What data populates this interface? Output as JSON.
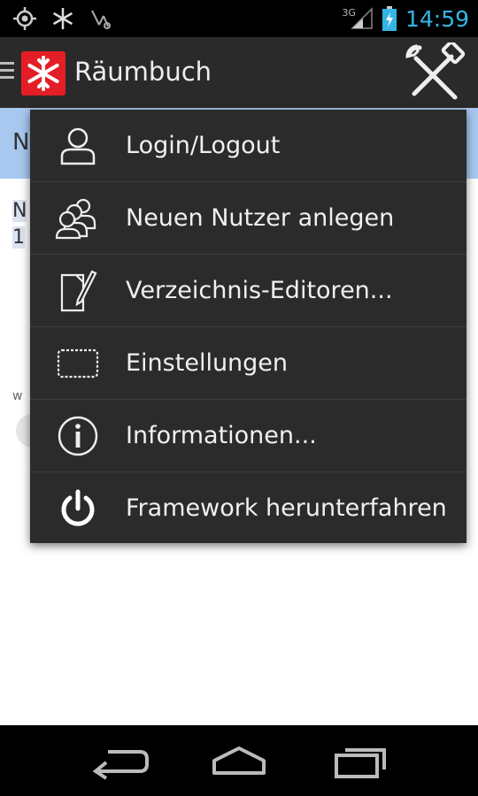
{
  "status_bar": {
    "network_type": "3G",
    "time": "14:59",
    "icons": [
      "gps-icon",
      "snowflake-notification-icon",
      "usb-debug-icon",
      "signal-icon",
      "battery-charging-icon"
    ]
  },
  "action_bar": {
    "title": "Räumbuch",
    "menu_icon": "tools-icon"
  },
  "background": {
    "strip_text": "N",
    "row1_text": "N",
    "row2_text": "1",
    "small_text": "w"
  },
  "menu": {
    "items": [
      {
        "label": "Login/Logout",
        "icon": "user-icon"
      },
      {
        "label": "Neuen Nutzer anlegen",
        "icon": "users-icon"
      },
      {
        "label": "Verzeichnis-Editoren...",
        "icon": "edit-document-icon"
      },
      {
        "label": "Einstellungen",
        "icon": "settings-card-icon"
      },
      {
        "label": "Informationen...",
        "icon": "info-icon"
      },
      {
        "label": "Framework herunterfahren",
        "icon": "power-icon"
      }
    ]
  },
  "nav_bar": {
    "buttons": [
      "back-icon",
      "home-icon",
      "recent-apps-icon"
    ]
  },
  "colors": {
    "clock": "#33b5e5",
    "action_bar": "#2a2a2a",
    "menu_bg": "#2b2b2b",
    "logo": "#e41e26"
  }
}
